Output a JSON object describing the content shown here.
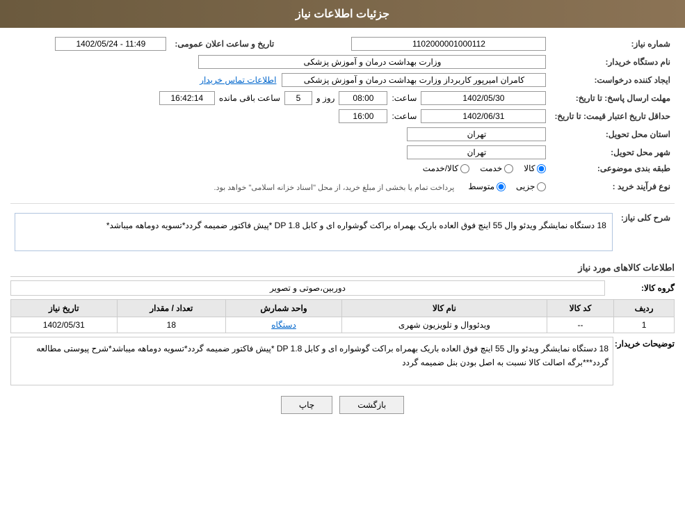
{
  "header": {
    "title": "جزئیات اطلاعات نیاز"
  },
  "fields": {
    "need_number_label": "شماره نیاز:",
    "need_number_value": "1102000001000112",
    "buyer_org_label": "نام دستگاه خریدار:",
    "buyer_org_value": "وزارت بهداشت  درمان و آموزش پزشکی",
    "requester_label": "ایجاد کننده درخواست:",
    "requester_value": "کامران امیرپور کاربرداز وزارت بهداشت  درمان و آموزش پزشکی",
    "contact_link": "اطلاعات تماس خریدار",
    "response_deadline_label": "مهلت ارسال پاسخ: تا تاریخ:",
    "response_date": "1402/05/30",
    "response_time_label": "ساعت:",
    "response_time": "08:00",
    "response_days_label": "روز و",
    "response_days": "5",
    "response_hours_label": "ساعت باقی مانده",
    "response_remaining": "16:42:14",
    "price_validity_label": "حداقل تاریخ اعتبار قیمت: تا تاریخ:",
    "price_validity_date": "1402/06/31",
    "price_validity_time_label": "ساعت:",
    "price_validity_time": "16:00",
    "province_label": "استان محل تحویل:",
    "province_value": "تهران",
    "city_label": "شهر محل تحویل:",
    "city_value": "تهران",
    "category_label": "طبقه بندی موضوعی:",
    "category_options": [
      "کالا",
      "خدمت",
      "کالا/خدمت"
    ],
    "category_selected": "کالا",
    "process_label": "نوع فرآیند خرید :",
    "process_options": [
      "جزیی",
      "متوسط"
    ],
    "process_selected": "متوسط",
    "process_note": "پرداخت تمام یا بخشی از مبلغ خرید، از محل \"اسناد خزانه اسلامی\" خواهد بود.",
    "announce_label": "تاریخ و ساعت اعلان عمومی:",
    "announce_value": "1402/05/24 - 11:49",
    "general_desc_label": "شرح کلی نیاز:",
    "general_desc_value": "18 دستگاه نمایشگر ویدئو وال 55 اینچ فوق العاده باریک بهمراه براکت گوشواره ای و کابل DP 1.8 *پیش فاکتور ضمیمه گردد*تسویه دوماهه میباشد*",
    "products_title": "اطلاعات کالاهای مورد نیاز",
    "product_group_label": "گروه کالا:",
    "product_group_value": "دوربین،صوتی و تصویر",
    "table_headers": {
      "row_num": "ردیف",
      "product_code": "کد کالا",
      "product_name": "نام کالا",
      "unit_code": "واحد شمارش",
      "quantity": "تعداد / مقدار",
      "need_date": "تاریخ نیاز"
    },
    "table_rows": [
      {
        "row_num": "1",
        "product_code": "--",
        "product_name": "ویدئووال و تلویزیون شهری",
        "unit_code": "دستگاه",
        "quantity": "18",
        "need_date": "1402/05/31"
      }
    ],
    "buyer_notes_label": "توضیحات خریدار:",
    "buyer_notes_value": "18 دستگاه نمایشگر ویدئو وال 55 اینچ فوق العاده باریک بهمراه براکت گوشواره ای و کابل DP 1.8 *پیش فاکتور ضمیمه گردد*تسویه دوماهه میباشد*شرح پیوستی مطالعه گردد***برگه اصالت کالا نسبت به اصل بودن بنل ضمیمه گردد"
  },
  "buttons": {
    "print": "چاپ",
    "back": "بازگشت"
  }
}
